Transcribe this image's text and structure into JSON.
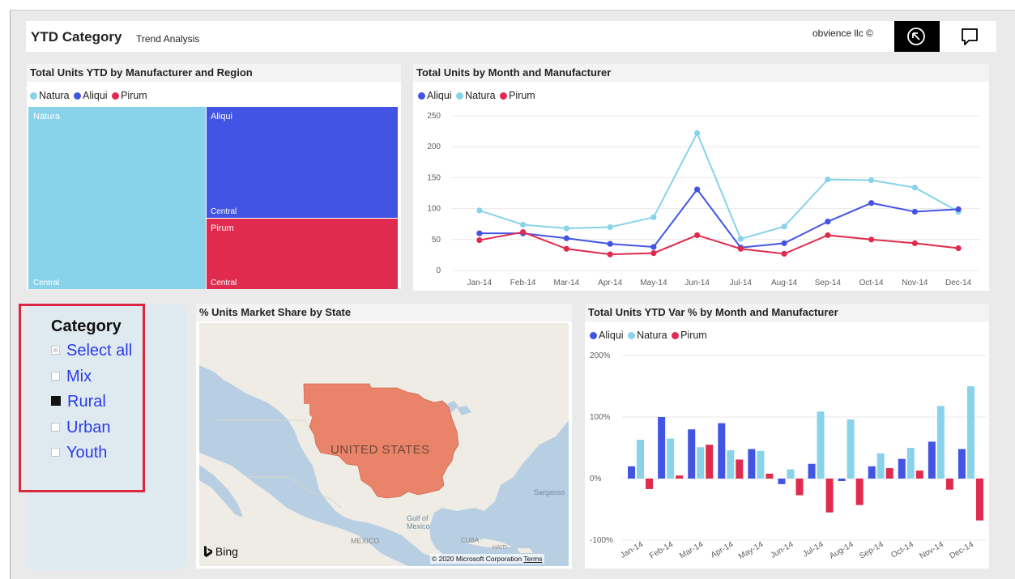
{
  "header": {
    "title": "YTD Category",
    "subtitle": "Trend Analysis",
    "company": "obvience llc ©",
    "back_icon": "arrow-circle-icon",
    "comment_icon": "speech-bubble-icon"
  },
  "colors": {
    "natura": "#88d3ea",
    "aliqui": "#4254e3",
    "pirum": "#e02b4e",
    "map_state": "#e9836a",
    "slicer_highlight": "#d9283f"
  },
  "treemap": {
    "title": "Total Units YTD by Manufacturer and Region",
    "legend": [
      "Natura",
      "Aliqui",
      "Pirum"
    ],
    "tiles": [
      {
        "manufacturer": "Natura",
        "region": "Central"
      },
      {
        "manufacturer": "Aliqui",
        "region": "Central"
      },
      {
        "manufacturer": "Pirum",
        "region": "Central"
      }
    ]
  },
  "line_chart": {
    "title": "Total Units by Month and Manufacturer",
    "legend": [
      "Aliqui",
      "Natura",
      "Pirum"
    ],
    "y_ticks": [
      "0",
      "50",
      "100",
      "150",
      "200",
      "250"
    ]
  },
  "slicer": {
    "title": "Category",
    "items": [
      {
        "label": "Select all",
        "state": "partial"
      },
      {
        "label": "Mix",
        "state": "off"
      },
      {
        "label": "Rural",
        "state": "on"
      },
      {
        "label": "Urban",
        "state": "off"
      },
      {
        "label": "Youth",
        "state": "off"
      }
    ]
  },
  "map": {
    "title": "% Units Market Share by State",
    "country_label": "UNITED STATES",
    "labels": {
      "mexico": "MEXICO",
      "gulf": "Gulf of\nMexico",
      "sargasso": "Sargasso",
      "cuba": "CUBA",
      "haiti": "HAITI"
    },
    "bing": "Bing",
    "copyright": "© 2020 Microsoft Corporation",
    "terms": "Terms"
  },
  "bar_chart": {
    "title": "Total Units YTD Var % by Month and Manufacturer",
    "legend": [
      "Aliqui",
      "Natura",
      "Pirum"
    ],
    "y_ticks": [
      "200%",
      "100%",
      "0%",
      "-100%"
    ]
  },
  "chart_data": [
    {
      "type": "line",
      "title": "Total Units by Month and Manufacturer",
      "categories": [
        "Jan-14",
        "Feb-14",
        "Mar-14",
        "Apr-14",
        "May-14",
        "Jun-14",
        "Jul-14",
        "Aug-14",
        "Sep-14",
        "Oct-14",
        "Nov-14",
        "Dec-14"
      ],
      "ylim": [
        0,
        250
      ],
      "grid": true,
      "legend_position": "top-left",
      "series": [
        {
          "name": "Aliqui",
          "color": "#4254e3",
          "values": [
            60,
            60,
            52,
            43,
            38,
            131,
            37,
            44,
            79,
            109,
            95,
            99
          ]
        },
        {
          "name": "Natura",
          "color": "#88d3ea",
          "values": [
            97,
            74,
            68,
            70,
            86,
            222,
            51,
            71,
            147,
            146,
            134,
            95
          ]
        },
        {
          "name": "Pirum",
          "color": "#e02b4e",
          "values": [
            49,
            62,
            35,
            26,
            28,
            57,
            35,
            27,
            57,
            50,
            44,
            36
          ]
        }
      ]
    },
    {
      "type": "bar",
      "title": "Total Units YTD Var % by Month and Manufacturer",
      "categories": [
        "Jan-14",
        "Feb-14",
        "Mar-14",
        "Apr-14",
        "May-14",
        "Jun-14",
        "Jul-14",
        "Aug-14",
        "Sep-14",
        "Oct-14",
        "Nov-14",
        "Dec-14"
      ],
      "ylim": [
        -100,
        200
      ],
      "unit": "%",
      "grid": true,
      "legend_position": "top-left",
      "series": [
        {
          "name": "Aliqui",
          "color": "#4254e3",
          "values": [
            20,
            100,
            80,
            90,
            48,
            -9,
            24,
            -4,
            20,
            32,
            60,
            48
          ]
        },
        {
          "name": "Natura",
          "color": "#88d3ea",
          "values": [
            63,
            65,
            51,
            46,
            45,
            15,
            109,
            96,
            41,
            50,
            118,
            150
          ]
        },
        {
          "name": "Pirum",
          "color": "#e02b4e",
          "values": [
            -17,
            5,
            55,
            31,
            8,
            -27,
            -55,
            -43,
            17,
            13,
            -18,
            -68
          ]
        }
      ]
    },
    {
      "type": "treemap",
      "title": "Total Units YTD by Manufacturer and Region",
      "items": [
        {
          "name": "Natura",
          "region": "Central"
        },
        {
          "name": "Aliqui",
          "region": "Central"
        },
        {
          "name": "Pirum",
          "region": "Central"
        }
      ]
    }
  ]
}
